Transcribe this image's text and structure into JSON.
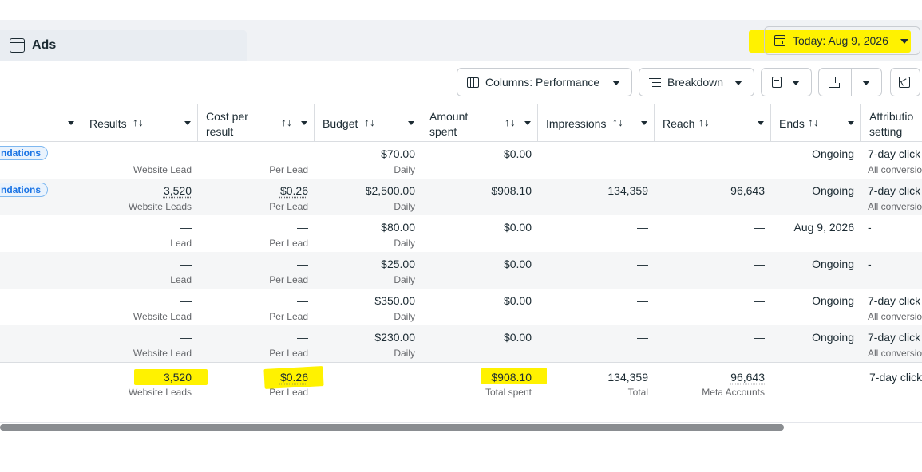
{
  "tab": {
    "label": "Ads",
    "icon": "window-icon"
  },
  "date_range": {
    "label": "Today: Aug 9, 2026",
    "icon": "calendar-icon",
    "highlight": "#fff200"
  },
  "toolbar": {
    "columns_label": "Columns: Performance",
    "breakdown_label": "Breakdown",
    "report_icon": "report-icon",
    "export_icon": "download-icon",
    "chart_icon": "chart-icon"
  },
  "columns": [
    {
      "key": "name",
      "label": ""
    },
    {
      "key": "results",
      "label": "Results",
      "sort": "↑↓"
    },
    {
      "key": "cost",
      "label": "Cost per\nresult",
      "sort": "↑↓"
    },
    {
      "key": "budget",
      "label": "Budget",
      "sort": "↑↓"
    },
    {
      "key": "amount",
      "label": "Amount\nspent",
      "sort": "↑↓"
    },
    {
      "key": "impressions",
      "label": "Impressions",
      "sort": "↑↓"
    },
    {
      "key": "reach",
      "label": "Reach",
      "sort": "↑↓"
    },
    {
      "key": "ends",
      "label": "Ends",
      "sort": "↑↓"
    },
    {
      "key": "attribution",
      "label": "Attributio\nsetting"
    }
  ],
  "rows": [
    {
      "name_pill": "ndations",
      "results": "—",
      "results_sub": "Website Lead",
      "cost": "—",
      "cost_sub": "Per Lead",
      "budget": "$70.00",
      "budget_sub": "Daily",
      "amount": "$0.00",
      "impressions": "—",
      "reach": "—",
      "ends": "Ongoing",
      "attribution": "7-day click",
      "attribution_sub": "All conversio"
    },
    {
      "name_pill": "ndations",
      "results": "3,520",
      "results_sub": "Website Leads",
      "cost": "$0.26",
      "cost_sub": "Per Lead",
      "budget": "$2,500.00",
      "budget_sub": "Daily",
      "amount": "$908.10",
      "impressions": "134,359",
      "reach": "96,643",
      "ends": "Ongoing",
      "attribution": "7-day click",
      "attribution_sub": "All conversio"
    },
    {
      "name_pill": "",
      "results": "—",
      "results_sub": "Lead",
      "cost": "—",
      "cost_sub": "Per Lead",
      "budget": "$80.00",
      "budget_sub": "Daily",
      "amount": "$0.00",
      "impressions": "—",
      "reach": "—",
      "ends": "Aug 9, 2026",
      "attribution": "-",
      "attribution_sub": ""
    },
    {
      "name_pill": "",
      "results": "—",
      "results_sub": "Lead",
      "cost": "—",
      "cost_sub": "Per Lead",
      "budget": "$25.00",
      "budget_sub": "Daily",
      "amount": "$0.00",
      "impressions": "—",
      "reach": "—",
      "ends": "Ongoing",
      "attribution": "-",
      "attribution_sub": ""
    },
    {
      "name_pill": "",
      "results": "—",
      "results_sub": "Website Lead",
      "cost": "—",
      "cost_sub": "Per Lead",
      "budget": "$350.00",
      "budget_sub": "Daily",
      "amount": "$0.00",
      "impressions": "—",
      "reach": "—",
      "ends": "Ongoing",
      "attribution": "7-day click",
      "attribution_sub": "All conversio"
    },
    {
      "name_pill": "",
      "results": "—",
      "results_sub": "Website Lead",
      "cost": "—",
      "cost_sub": "Per Lead",
      "budget": "$230.00",
      "budget_sub": "Daily",
      "amount": "$0.00",
      "impressions": "—",
      "reach": "—",
      "ends": "Ongoing",
      "attribution": "7-day click",
      "attribution_sub": "All conversio"
    }
  ],
  "totals": {
    "results": "3,520",
    "results_sub": "Website Leads",
    "cost": "$0.26",
    "cost_sub": "Per Lead",
    "amount": "$908.10",
    "amount_sub": "Total spent",
    "impressions": "134,359",
    "impressions_sub": "Total",
    "reach": "96,643",
    "reach_sub": "Meta Accounts",
    "attribution": "7-day click"
  }
}
